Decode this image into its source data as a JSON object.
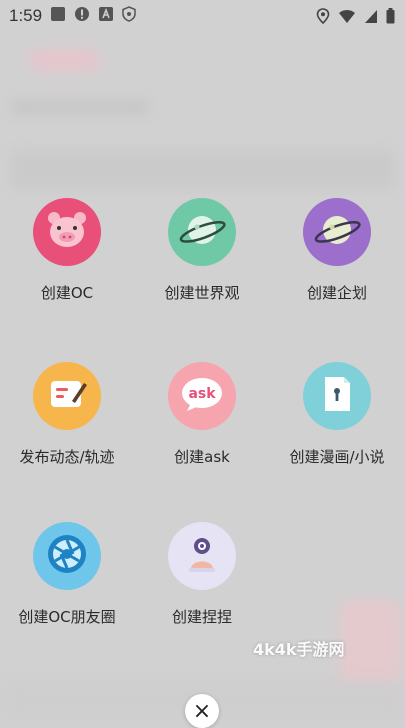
{
  "status_bar": {
    "time": "1:59",
    "left_icons": [
      "notification-square-icon",
      "alert-circle-icon",
      "app-a-icon",
      "shield-icon"
    ],
    "right_icons": [
      "location-icon",
      "wifi-icon",
      "signal-icon",
      "battery-icon"
    ]
  },
  "menu": {
    "items": [
      {
        "label": "创建OC",
        "icon": "pig-face-icon",
        "color": "#e84f79"
      },
      {
        "label": "创建世界观",
        "icon": "planet-icon",
        "color": "#6fc9a6"
      },
      {
        "label": "创建企划",
        "icon": "planet-icon",
        "color": "#9b6fcb"
      },
      {
        "label": "发布动态/轨迹",
        "icon": "edit-note-icon",
        "color": "#f7b64b"
      },
      {
        "label": "创建ask",
        "icon": "ask-bubble-icon",
        "color": "#f6a4ad"
      },
      {
        "label": "创建漫画/小说",
        "icon": "book-icon",
        "color": "#7fd0d8"
      },
      {
        "label": "创建OC朋友圈",
        "icon": "camera-aperture-icon",
        "color": "#6ec6ea"
      },
      {
        "label": "创建捏捏",
        "icon": "doll-icon",
        "color": "#e6e3f4"
      }
    ]
  },
  "watermark": "4k4k手游网",
  "close_button": {
    "symbol": "×"
  }
}
